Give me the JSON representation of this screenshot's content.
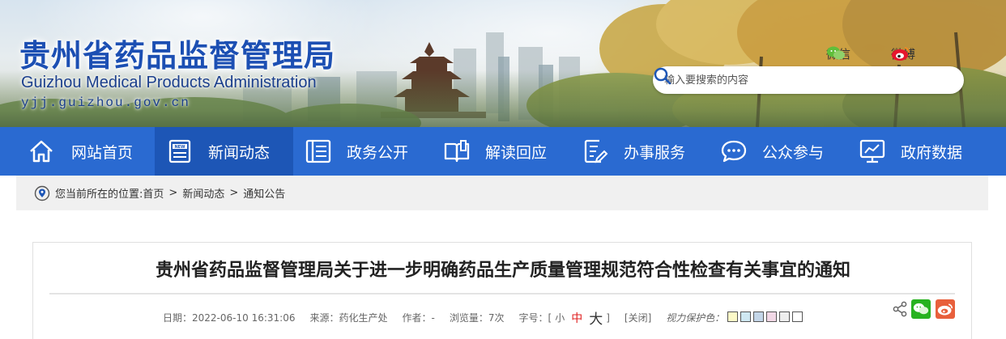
{
  "header": {
    "title_cn": "贵州省药品监督管理局",
    "title_en": "Guizhou Medical Products Administration",
    "url": "yjj.guizhou.gov.cn",
    "social": {
      "wechat_label": "微信",
      "weibo_label": "微博"
    },
    "search": {
      "placeholder": "输入要搜索的内容"
    }
  },
  "nav": {
    "items": [
      {
        "label": "网站首页",
        "icon": "home-icon",
        "active": false
      },
      {
        "label": "新闻动态",
        "icon": "news-icon",
        "active": true
      },
      {
        "label": "政务公开",
        "icon": "document-list-icon",
        "active": false
      },
      {
        "label": "解读回应",
        "icon": "open-book-icon",
        "active": false
      },
      {
        "label": "办事服务",
        "icon": "form-icon",
        "active": false
      },
      {
        "label": "公众参与",
        "icon": "chat-bubble-icon",
        "active": false
      },
      {
        "label": "政府数据",
        "icon": "data-monitor-icon",
        "active": false
      }
    ]
  },
  "breadcrumb": {
    "prefix": "您当前所在的位置: ",
    "items": [
      "首页",
      "新闻动态",
      "通知公告"
    ],
    "separator": ">"
  },
  "article": {
    "title": "贵州省药品监督管理局关于进一步明确药品生产质量管理规范符合性检查有关事宜的通知",
    "meta": {
      "date_label": "日期：",
      "date": "2022-06-10 16:31:06",
      "source_label": "来源：",
      "source": "药化生产处",
      "author_label": "作者：",
      "author": "-",
      "views_label": "浏览量：",
      "views": "7次",
      "fontsize_label": "字号：[",
      "fontsize_small": "小",
      "fontsize_medium": "中",
      "fontsize_large": "大",
      "fontsize_close": "]",
      "close_label": "[关闭]",
      "vision_label": "视力保护色："
    },
    "vision_colors": [
      "#fcf9c8",
      "#cfe8f2",
      "#c4d6e8",
      "#f2d8e6",
      "#eeeeee",
      "#ffffff"
    ]
  },
  "colors": {
    "nav_bg": "#2a6ad1",
    "nav_active": "#1d56b6",
    "title_blue": "#1c4fb3",
    "wechat_green": "#27b21f",
    "weibo_orange": "#e8603c"
  }
}
